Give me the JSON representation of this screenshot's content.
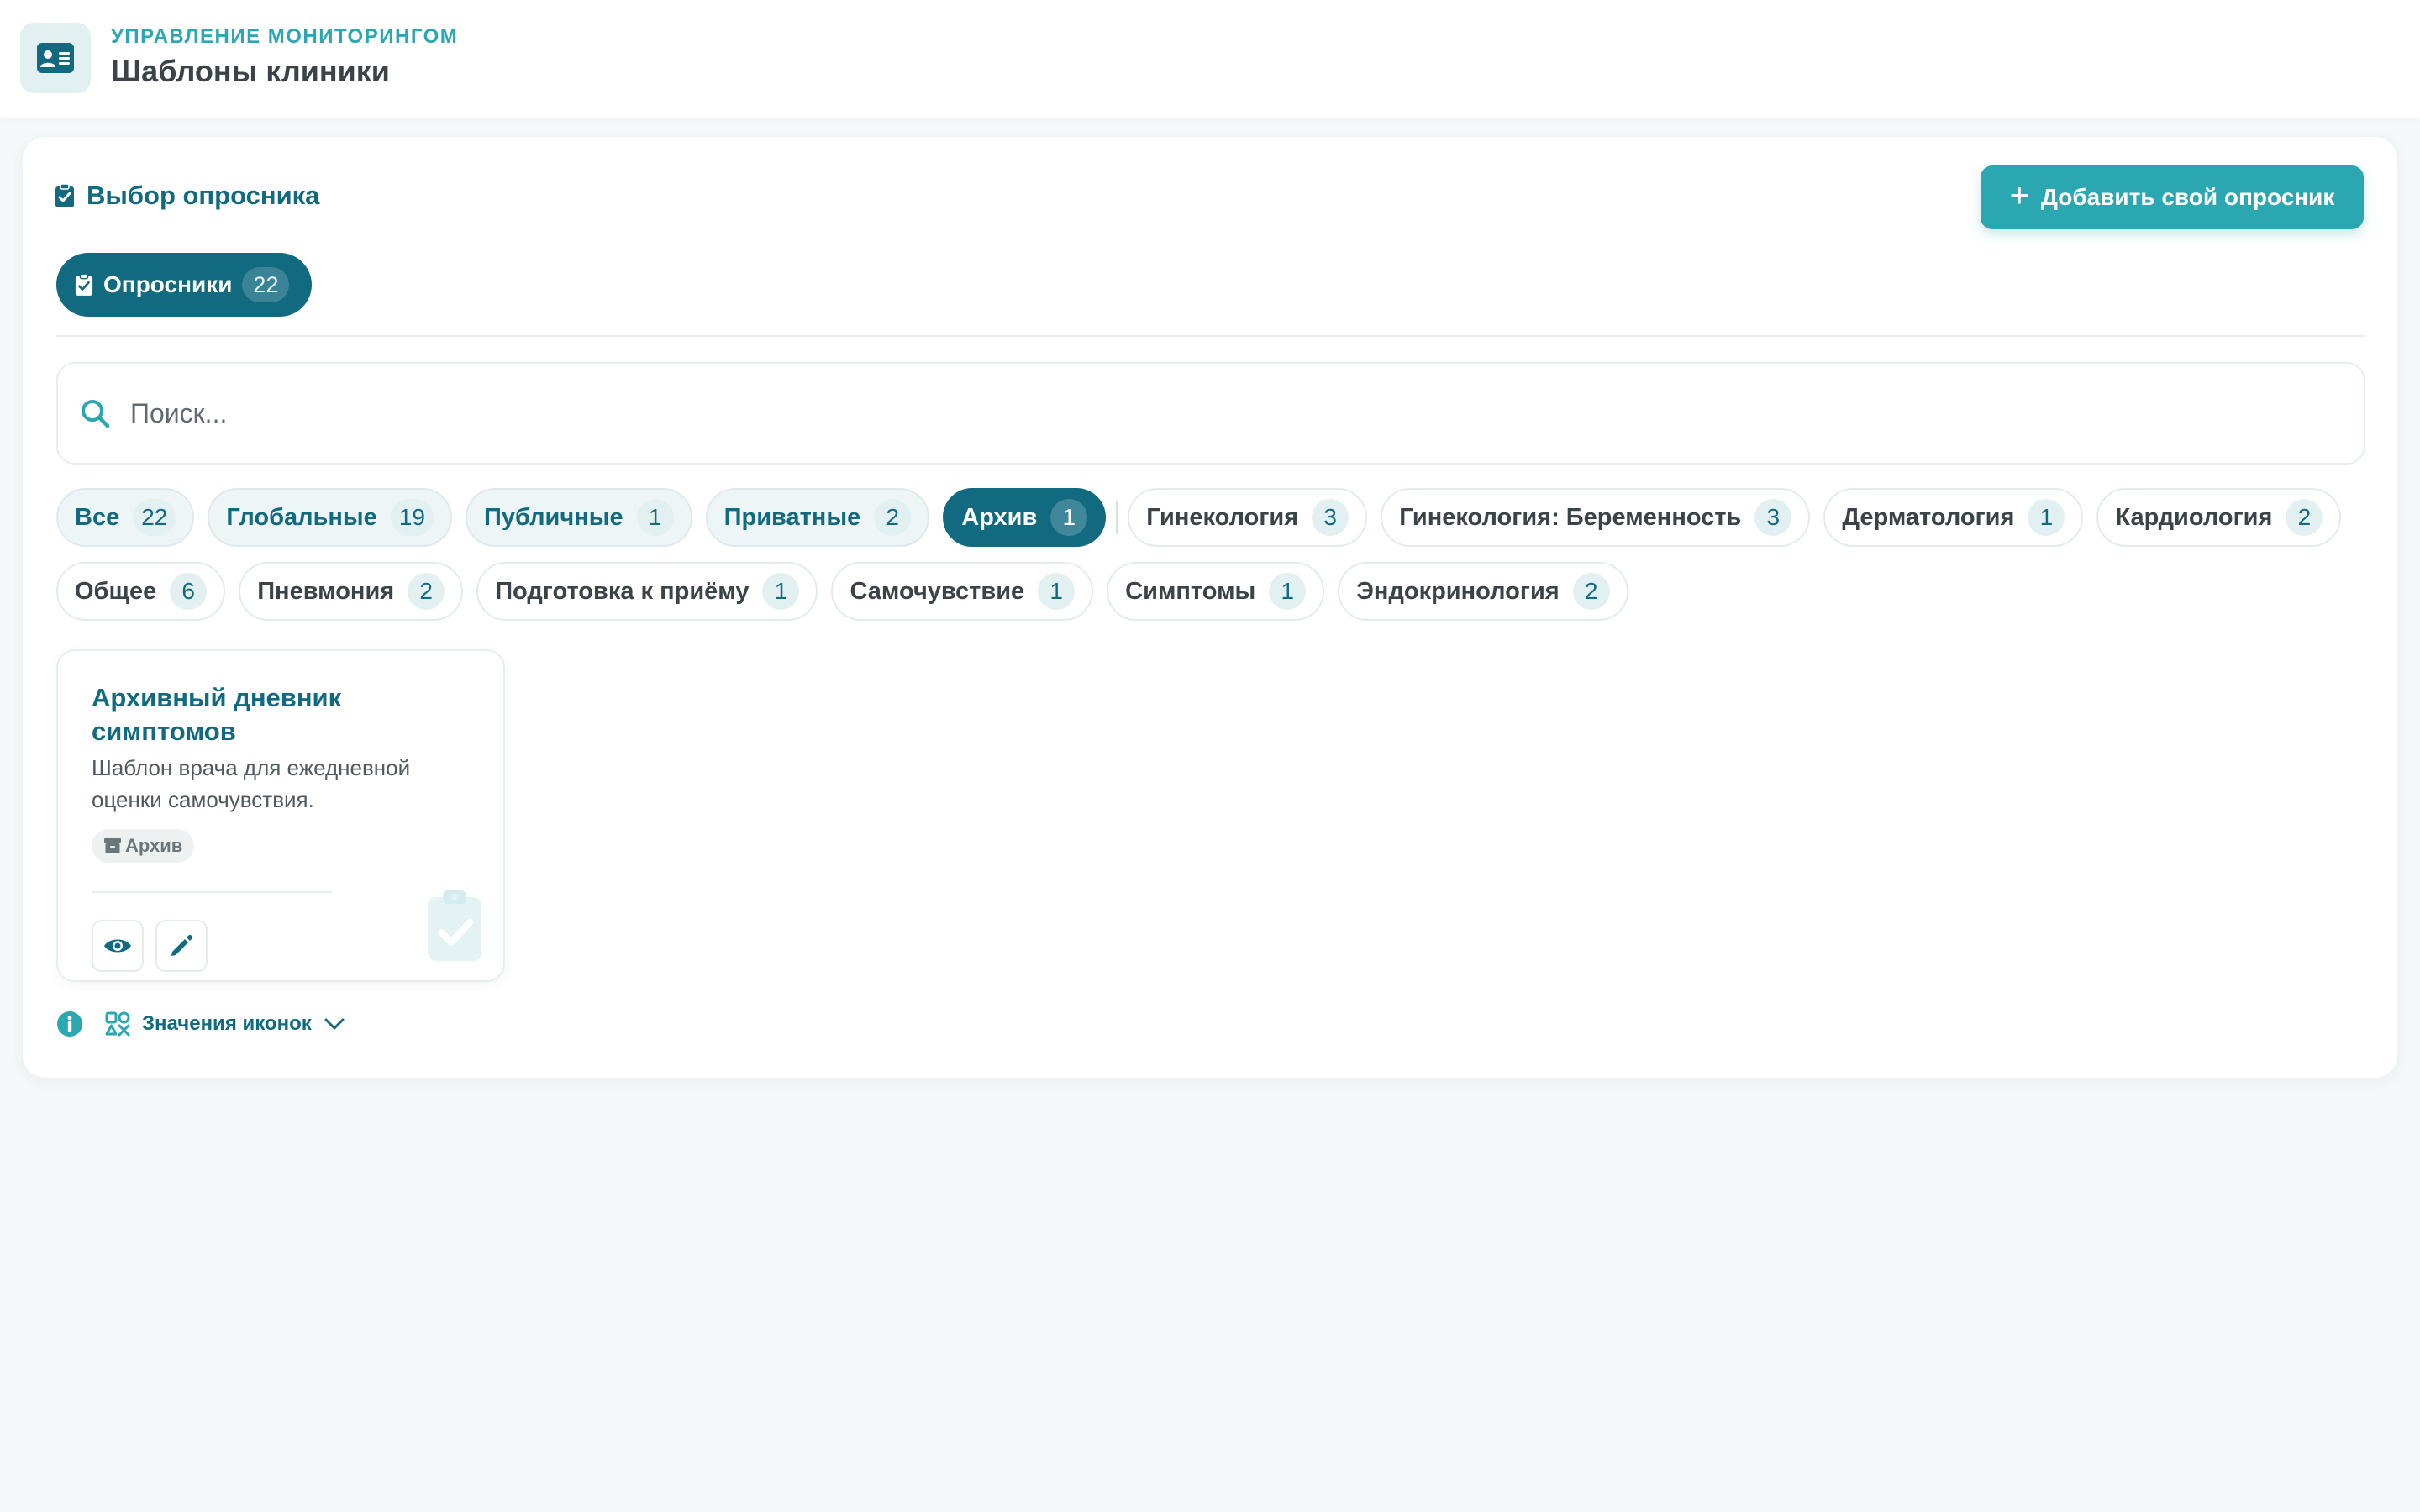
{
  "header": {
    "kicker": "Управление мониторингом",
    "title": "Шаблоны клиники",
    "logo_icon": "id-card-icon"
  },
  "section": {
    "title": "Выбор опросника",
    "icon": "clipboard-check-icon",
    "add_button_label": "Добавить свой опросник"
  },
  "type_tab": {
    "label": "Опросники",
    "count": "22"
  },
  "search": {
    "placeholder": "Поиск..."
  },
  "filters": {
    "status": [
      {
        "label": "Все",
        "count": "22"
      },
      {
        "label": "Глобальные",
        "count": "19"
      },
      {
        "label": "Публичные",
        "count": "1"
      },
      {
        "label": "Приватные",
        "count": "2"
      },
      {
        "label": "Архив",
        "count": "1",
        "active": true
      }
    ],
    "categories": [
      {
        "label": "Гинекология",
        "count": "3"
      },
      {
        "label": "Гинекология: Беременность",
        "count": "3"
      },
      {
        "label": "Дерматология",
        "count": "1"
      },
      {
        "label": "Кардиология",
        "count": "2"
      },
      {
        "label": "Общее",
        "count": "6"
      },
      {
        "label": "Пневмония",
        "count": "2"
      },
      {
        "label": "Подготовка к приёму",
        "count": "1"
      },
      {
        "label": "Самочувствие",
        "count": "1"
      },
      {
        "label": "Симптомы",
        "count": "1"
      },
      {
        "label": "Эндокринология",
        "count": "2"
      }
    ]
  },
  "card": {
    "title": "Архивный дневник симптомов",
    "description": "Шаблон врача для ежедневной оценки самочувствия.",
    "badge": "Архив",
    "actions": [
      "eye-icon",
      "pencil-icon"
    ]
  },
  "footer": {
    "legend_label": "Значения иконок"
  },
  "colors": {
    "primary": "#116a80",
    "accent": "#2aa7b0",
    "background": "#f5f8f9"
  }
}
